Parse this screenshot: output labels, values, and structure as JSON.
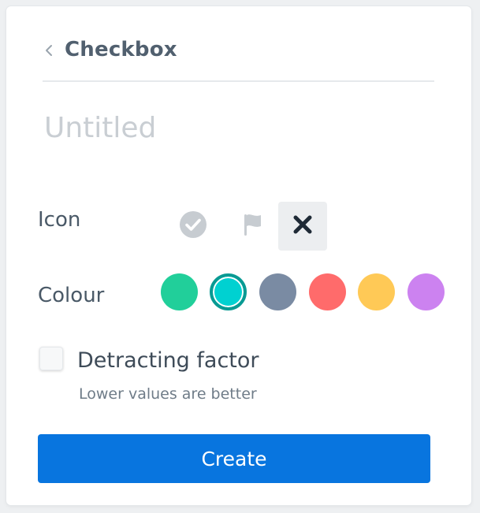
{
  "header": {
    "back_icon": "chevron-left-icon",
    "title": "Checkbox"
  },
  "name_field": {
    "value": "",
    "placeholder": "Untitled"
  },
  "icon_row": {
    "label": "Icon",
    "options": [
      {
        "name": "check-circle-icon",
        "selected": false
      },
      {
        "name": "flag-icon",
        "selected": false
      },
      {
        "name": "cross-icon",
        "selected": true
      }
    ]
  },
  "colour_row": {
    "label": "Colour",
    "swatches": [
      {
        "name": "green",
        "color": "#21cf9a",
        "selected": false
      },
      {
        "name": "teal",
        "color": "#00d1d1",
        "selected": true
      },
      {
        "name": "slate",
        "color": "#7a8ba3",
        "selected": false
      },
      {
        "name": "red",
        "color": "#ff6b6b",
        "selected": false
      },
      {
        "name": "yellow",
        "color": "#ffc956",
        "selected": false
      },
      {
        "name": "purple",
        "color": "#cc82f0",
        "selected": false
      }
    ]
  },
  "detracting": {
    "checked": false,
    "label": "Detracting factor",
    "hint": "Lower values are better"
  },
  "create_button": {
    "label": "Create",
    "color": "#0875df"
  }
}
